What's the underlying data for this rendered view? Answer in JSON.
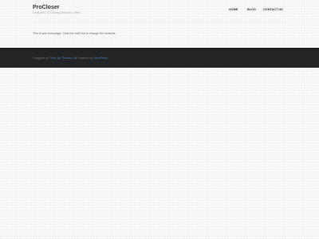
{
  "site": {
    "title": "ProCloser",
    "tagline": "Dedicated To Closing Deal and Offers"
  },
  "nav": {
    "items": [
      {
        "label": "HOME"
      },
      {
        "label": "BLOG"
      },
      {
        "label": "CONTACT US"
      }
    ]
  },
  "content": {
    "text": "This is your front page. Click the 'edit' link to change the contents."
  },
  "footer": {
    "prefix": "Designed by",
    "theme_link": "Think Up Themes Ltd",
    "middle": "Powered by",
    "wp_link": "WordPress"
  },
  "colors": {
    "background": "#fafafa",
    "footer_background": "#232425",
    "link": "#4e82b9"
  }
}
